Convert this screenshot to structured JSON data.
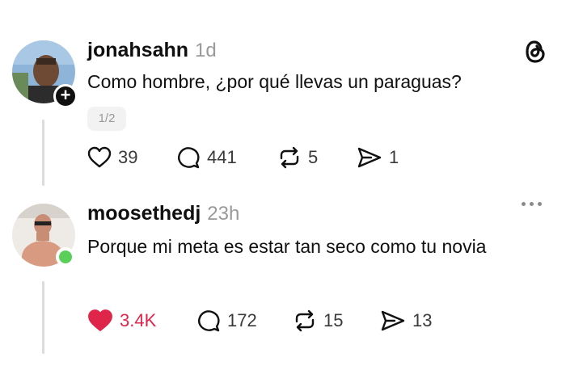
{
  "post1": {
    "username": "jonahsahn",
    "time": "1d",
    "text": "Como hombre, ¿por qué llevas un paraguas?",
    "counter": "1/2",
    "likes": "39",
    "comments": "441",
    "reposts": "5",
    "shares": "1",
    "icons": [
      "heart-icon",
      "comment-icon",
      "repost-icon",
      "share-icon",
      "threads-logo-icon",
      "plus-icon"
    ]
  },
  "post2": {
    "username": "moosethedj",
    "time": "23h",
    "text": "Porque mi meta es estar tan seco como tu novia",
    "likes": "3.4K",
    "comments": "172",
    "reposts": "15",
    "shares": "13",
    "like_color": "#e0254a",
    "icons": [
      "heart-filled-icon",
      "comment-icon",
      "repost-icon",
      "share-icon",
      "more-icon",
      "online-status-icon"
    ]
  }
}
